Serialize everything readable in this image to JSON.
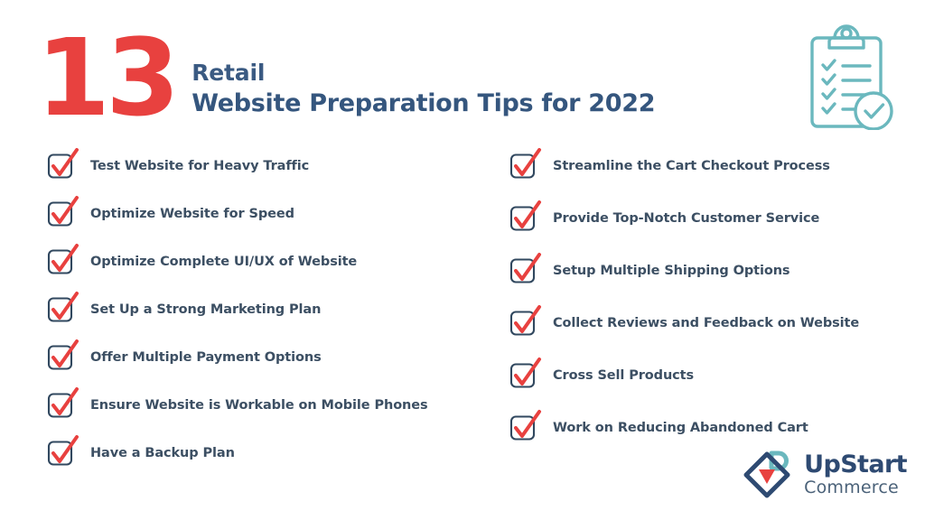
{
  "header": {
    "number": "13",
    "title_line1": "Retail",
    "title_line2": "Website Preparation Tips for 2022"
  },
  "icons": {
    "clipboard": "clipboard-checklist-icon",
    "checkbox": "checkbox-checked-icon",
    "logo_mark": "upstart-diamond-bag-icon"
  },
  "checklist": {
    "left_column": [
      {
        "label": "Test Website for Heavy Traffic"
      },
      {
        "label": "Optimize Website for Speed"
      },
      {
        "label": "Optimize Complete UI/UX of Website"
      },
      {
        "label": " Set Up a Strong Marketing Plan"
      },
      {
        "label": "Offer Multiple Payment Options"
      },
      {
        "label": "Ensure Website is Workable on Mobile Phones"
      },
      {
        "label": "Have a Backup Plan"
      }
    ],
    "right_column": [
      {
        "label": "Streamline the Cart Checkout Process"
      },
      {
        "label": "Provide Top-Notch Customer Service"
      },
      {
        "label": "Setup Multiple Shipping Options"
      },
      {
        "label": "Collect Reviews and Feedback on Website"
      },
      {
        "label": "Cross Sell Products"
      },
      {
        "label": "Work on Reducing Abandoned Cart"
      }
    ]
  },
  "logo": {
    "name": "UpStart",
    "subtitle": "Commerce"
  },
  "colors": {
    "red": "#e8413f",
    "navy": "#35567e",
    "slate": "#3c4f63",
    "teal": "#6bb8be",
    "background": "#ffffff"
  }
}
